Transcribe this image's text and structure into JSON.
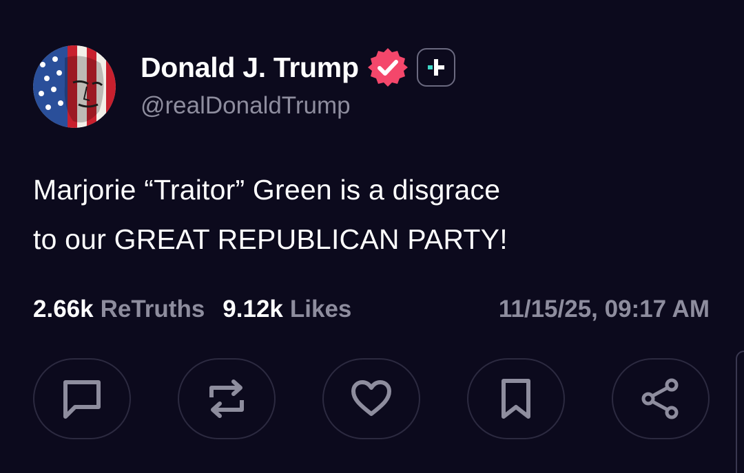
{
  "author": {
    "display_name": "Donald J. Trump",
    "handle": "@realDonaldTrump",
    "avatar_icon": "flag-painted-face-avatar",
    "verified_icon": "verified-badge-icon",
    "verified_color": "#f4476b",
    "follow_icon": "plus-icon"
  },
  "post": {
    "text_line1": "Marjorie “Traitor” Green is a disgrace",
    "text_line2": "to our GREAT REPUBLICAN PARTY!"
  },
  "stats": {
    "retruths_count": "2.66k",
    "retruths_label": "ReTruths",
    "likes_count": "9.12k",
    "likes_label": "Likes",
    "timestamp": "11/15/25, 09:17 AM"
  },
  "actions": [
    {
      "name": "reply",
      "icon": "comment-icon"
    },
    {
      "name": "retruth",
      "icon": "repost-icon"
    },
    {
      "name": "like",
      "icon": "heart-icon"
    },
    {
      "name": "bookmark",
      "icon": "bookmark-icon"
    },
    {
      "name": "share",
      "icon": "share-icon"
    }
  ],
  "colors": {
    "background": "#0c0a1d",
    "text_primary": "#ffffff",
    "text_secondary": "#8e8d9e",
    "accent_teal": "#3fd8c8",
    "button_border": "#2c2a40"
  }
}
